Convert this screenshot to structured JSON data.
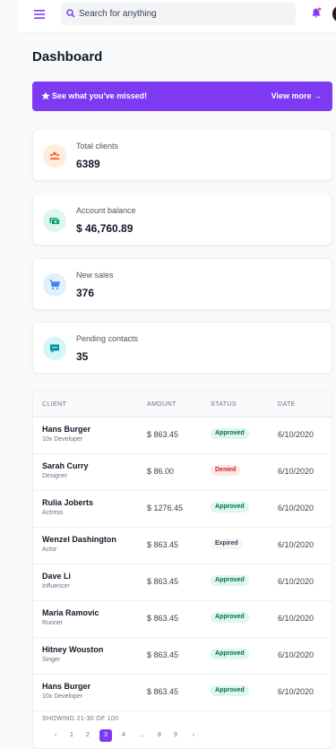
{
  "header": {
    "search_placeholder": "Search for anything"
  },
  "colors": {
    "accent": "#7e3af2",
    "notify": "#f05252"
  },
  "page": {
    "title": "Dashboard"
  },
  "banner": {
    "message": "See what you've missed!",
    "action": "View more →"
  },
  "cards": [
    {
      "label": "Total clients",
      "value": "6389",
      "icon": "users-icon",
      "bg": "#feecdc",
      "fg": "#ff5a1f"
    },
    {
      "label": "Account balance",
      "value": "$ 46,760.89",
      "icon": "cash-icon",
      "bg": "#def7ec",
      "fg": "#0e9f6e"
    },
    {
      "label": "New sales",
      "value": "376",
      "icon": "cart-icon",
      "bg": "#e1effe",
      "fg": "#3f83f8"
    },
    {
      "label": "Pending contacts",
      "value": "35",
      "icon": "chat-icon",
      "bg": "#d5f5f6",
      "fg": "#0694a2"
    }
  ],
  "table": {
    "headers": {
      "client": "CLIENT",
      "amount": "AMOUNT",
      "status": "STATUS",
      "date": "DATE"
    },
    "rows": [
      {
        "name": "Hans Burger",
        "role": "10x Developer",
        "amount": "$ 863.45",
        "status": "Approved",
        "date": "6/10/2020"
      },
      {
        "name": "Sarah Curry",
        "role": "Designer",
        "amount": "$ 86.00",
        "status": "Denied",
        "date": "6/10/2020"
      },
      {
        "name": "Rulia Joberts",
        "role": "Actress",
        "amount": "$ 1276.45",
        "status": "Approved",
        "date": "6/10/2020"
      },
      {
        "name": "Wenzel Dashington",
        "role": "Actor",
        "amount": "$ 863.45",
        "status": "Expired",
        "date": "6/10/2020"
      },
      {
        "name": "Dave Li",
        "role": "Influencer",
        "amount": "$ 863.45",
        "status": "Approved",
        "date": "6/10/2020"
      },
      {
        "name": "Maria Ramovic",
        "role": "Runner",
        "amount": "$ 863.45",
        "status": "Approved",
        "date": "6/10/2020"
      },
      {
        "name": "Hitney Wouston",
        "role": "Singer",
        "amount": "$ 863.45",
        "status": "Approved",
        "date": "6/10/2020"
      },
      {
        "name": "Hans Burger",
        "role": "10x Developer",
        "amount": "$ 863.45",
        "status": "Approved",
        "date": "6/10/2020"
      }
    ],
    "showing": "SHOWING 21-30 OF 100",
    "pagination": {
      "prev": "‹",
      "next": "›",
      "pages": [
        "1",
        "2",
        "3",
        "4",
        "...",
        "8",
        "9"
      ],
      "active": "3"
    }
  }
}
